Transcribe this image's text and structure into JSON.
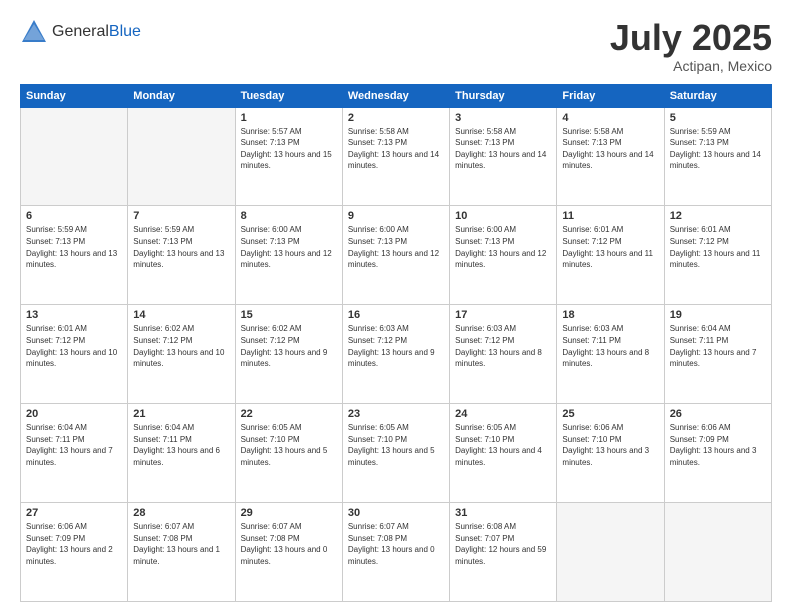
{
  "header": {
    "logo_general": "General",
    "logo_blue": "Blue",
    "title": "July 2025",
    "location": "Actipan, Mexico"
  },
  "weekdays": [
    "Sunday",
    "Monday",
    "Tuesday",
    "Wednesday",
    "Thursday",
    "Friday",
    "Saturday"
  ],
  "weeks": [
    [
      {
        "day": "",
        "empty": true
      },
      {
        "day": "",
        "empty": true
      },
      {
        "day": "1",
        "sunrise": "Sunrise: 5:57 AM",
        "sunset": "Sunset: 7:13 PM",
        "daylight": "Daylight: 13 hours and 15 minutes."
      },
      {
        "day": "2",
        "sunrise": "Sunrise: 5:58 AM",
        "sunset": "Sunset: 7:13 PM",
        "daylight": "Daylight: 13 hours and 14 minutes."
      },
      {
        "day": "3",
        "sunrise": "Sunrise: 5:58 AM",
        "sunset": "Sunset: 7:13 PM",
        "daylight": "Daylight: 13 hours and 14 minutes."
      },
      {
        "day": "4",
        "sunrise": "Sunrise: 5:58 AM",
        "sunset": "Sunset: 7:13 PM",
        "daylight": "Daylight: 13 hours and 14 minutes."
      },
      {
        "day": "5",
        "sunrise": "Sunrise: 5:59 AM",
        "sunset": "Sunset: 7:13 PM",
        "daylight": "Daylight: 13 hours and 14 minutes."
      }
    ],
    [
      {
        "day": "6",
        "sunrise": "Sunrise: 5:59 AM",
        "sunset": "Sunset: 7:13 PM",
        "daylight": "Daylight: 13 hours and 13 minutes."
      },
      {
        "day": "7",
        "sunrise": "Sunrise: 5:59 AM",
        "sunset": "Sunset: 7:13 PM",
        "daylight": "Daylight: 13 hours and 13 minutes."
      },
      {
        "day": "8",
        "sunrise": "Sunrise: 6:00 AM",
        "sunset": "Sunset: 7:13 PM",
        "daylight": "Daylight: 13 hours and 12 minutes."
      },
      {
        "day": "9",
        "sunrise": "Sunrise: 6:00 AM",
        "sunset": "Sunset: 7:13 PM",
        "daylight": "Daylight: 13 hours and 12 minutes."
      },
      {
        "day": "10",
        "sunrise": "Sunrise: 6:00 AM",
        "sunset": "Sunset: 7:13 PM",
        "daylight": "Daylight: 13 hours and 12 minutes."
      },
      {
        "day": "11",
        "sunrise": "Sunrise: 6:01 AM",
        "sunset": "Sunset: 7:12 PM",
        "daylight": "Daylight: 13 hours and 11 minutes."
      },
      {
        "day": "12",
        "sunrise": "Sunrise: 6:01 AM",
        "sunset": "Sunset: 7:12 PM",
        "daylight": "Daylight: 13 hours and 11 minutes."
      }
    ],
    [
      {
        "day": "13",
        "sunrise": "Sunrise: 6:01 AM",
        "sunset": "Sunset: 7:12 PM",
        "daylight": "Daylight: 13 hours and 10 minutes."
      },
      {
        "day": "14",
        "sunrise": "Sunrise: 6:02 AM",
        "sunset": "Sunset: 7:12 PM",
        "daylight": "Daylight: 13 hours and 10 minutes."
      },
      {
        "day": "15",
        "sunrise": "Sunrise: 6:02 AM",
        "sunset": "Sunset: 7:12 PM",
        "daylight": "Daylight: 13 hours and 9 minutes."
      },
      {
        "day": "16",
        "sunrise": "Sunrise: 6:03 AM",
        "sunset": "Sunset: 7:12 PM",
        "daylight": "Daylight: 13 hours and 9 minutes."
      },
      {
        "day": "17",
        "sunrise": "Sunrise: 6:03 AM",
        "sunset": "Sunset: 7:12 PM",
        "daylight": "Daylight: 13 hours and 8 minutes."
      },
      {
        "day": "18",
        "sunrise": "Sunrise: 6:03 AM",
        "sunset": "Sunset: 7:11 PM",
        "daylight": "Daylight: 13 hours and 8 minutes."
      },
      {
        "day": "19",
        "sunrise": "Sunrise: 6:04 AM",
        "sunset": "Sunset: 7:11 PM",
        "daylight": "Daylight: 13 hours and 7 minutes."
      }
    ],
    [
      {
        "day": "20",
        "sunrise": "Sunrise: 6:04 AM",
        "sunset": "Sunset: 7:11 PM",
        "daylight": "Daylight: 13 hours and 7 minutes."
      },
      {
        "day": "21",
        "sunrise": "Sunrise: 6:04 AM",
        "sunset": "Sunset: 7:11 PM",
        "daylight": "Daylight: 13 hours and 6 minutes."
      },
      {
        "day": "22",
        "sunrise": "Sunrise: 6:05 AM",
        "sunset": "Sunset: 7:10 PM",
        "daylight": "Daylight: 13 hours and 5 minutes."
      },
      {
        "day": "23",
        "sunrise": "Sunrise: 6:05 AM",
        "sunset": "Sunset: 7:10 PM",
        "daylight": "Daylight: 13 hours and 5 minutes."
      },
      {
        "day": "24",
        "sunrise": "Sunrise: 6:05 AM",
        "sunset": "Sunset: 7:10 PM",
        "daylight": "Daylight: 13 hours and 4 minutes."
      },
      {
        "day": "25",
        "sunrise": "Sunrise: 6:06 AM",
        "sunset": "Sunset: 7:10 PM",
        "daylight": "Daylight: 13 hours and 3 minutes."
      },
      {
        "day": "26",
        "sunrise": "Sunrise: 6:06 AM",
        "sunset": "Sunset: 7:09 PM",
        "daylight": "Daylight: 13 hours and 3 minutes."
      }
    ],
    [
      {
        "day": "27",
        "sunrise": "Sunrise: 6:06 AM",
        "sunset": "Sunset: 7:09 PM",
        "daylight": "Daylight: 13 hours and 2 minutes."
      },
      {
        "day": "28",
        "sunrise": "Sunrise: 6:07 AM",
        "sunset": "Sunset: 7:08 PM",
        "daylight": "Daylight: 13 hours and 1 minute."
      },
      {
        "day": "29",
        "sunrise": "Sunrise: 6:07 AM",
        "sunset": "Sunset: 7:08 PM",
        "daylight": "Daylight: 13 hours and 0 minutes."
      },
      {
        "day": "30",
        "sunrise": "Sunrise: 6:07 AM",
        "sunset": "Sunset: 7:08 PM",
        "daylight": "Daylight: 13 hours and 0 minutes."
      },
      {
        "day": "31",
        "sunrise": "Sunrise: 6:08 AM",
        "sunset": "Sunset: 7:07 PM",
        "daylight": "Daylight: 12 hours and 59 minutes."
      },
      {
        "day": "",
        "empty": true
      },
      {
        "day": "",
        "empty": true
      }
    ]
  ]
}
